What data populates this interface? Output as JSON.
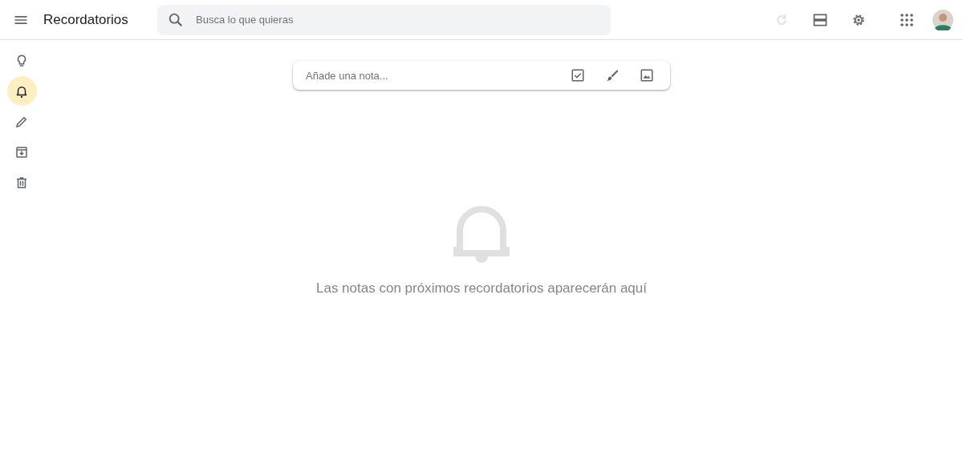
{
  "app_title": "Recordatorios",
  "search": {
    "placeholder": "Busca lo que quieras"
  },
  "toolbar": [
    {
      "kind": "refresh",
      "disabled": true
    },
    {
      "kind": "list-view",
      "disabled": false
    },
    {
      "kind": "settings",
      "disabled": false
    }
  ],
  "sidebar": {
    "items": [
      {
        "kind": "notes",
        "selected": false
      },
      {
        "kind": "reminders",
        "selected": true
      },
      {
        "kind": "edit-labels",
        "selected": false
      },
      {
        "kind": "archive",
        "selected": false
      },
      {
        "kind": "trash",
        "selected": false
      }
    ]
  },
  "note_input": {
    "placeholder": "Añade una nota..."
  },
  "empty_state": {
    "message": "Las notas con próximos recordatorios aparecerán aquí"
  }
}
